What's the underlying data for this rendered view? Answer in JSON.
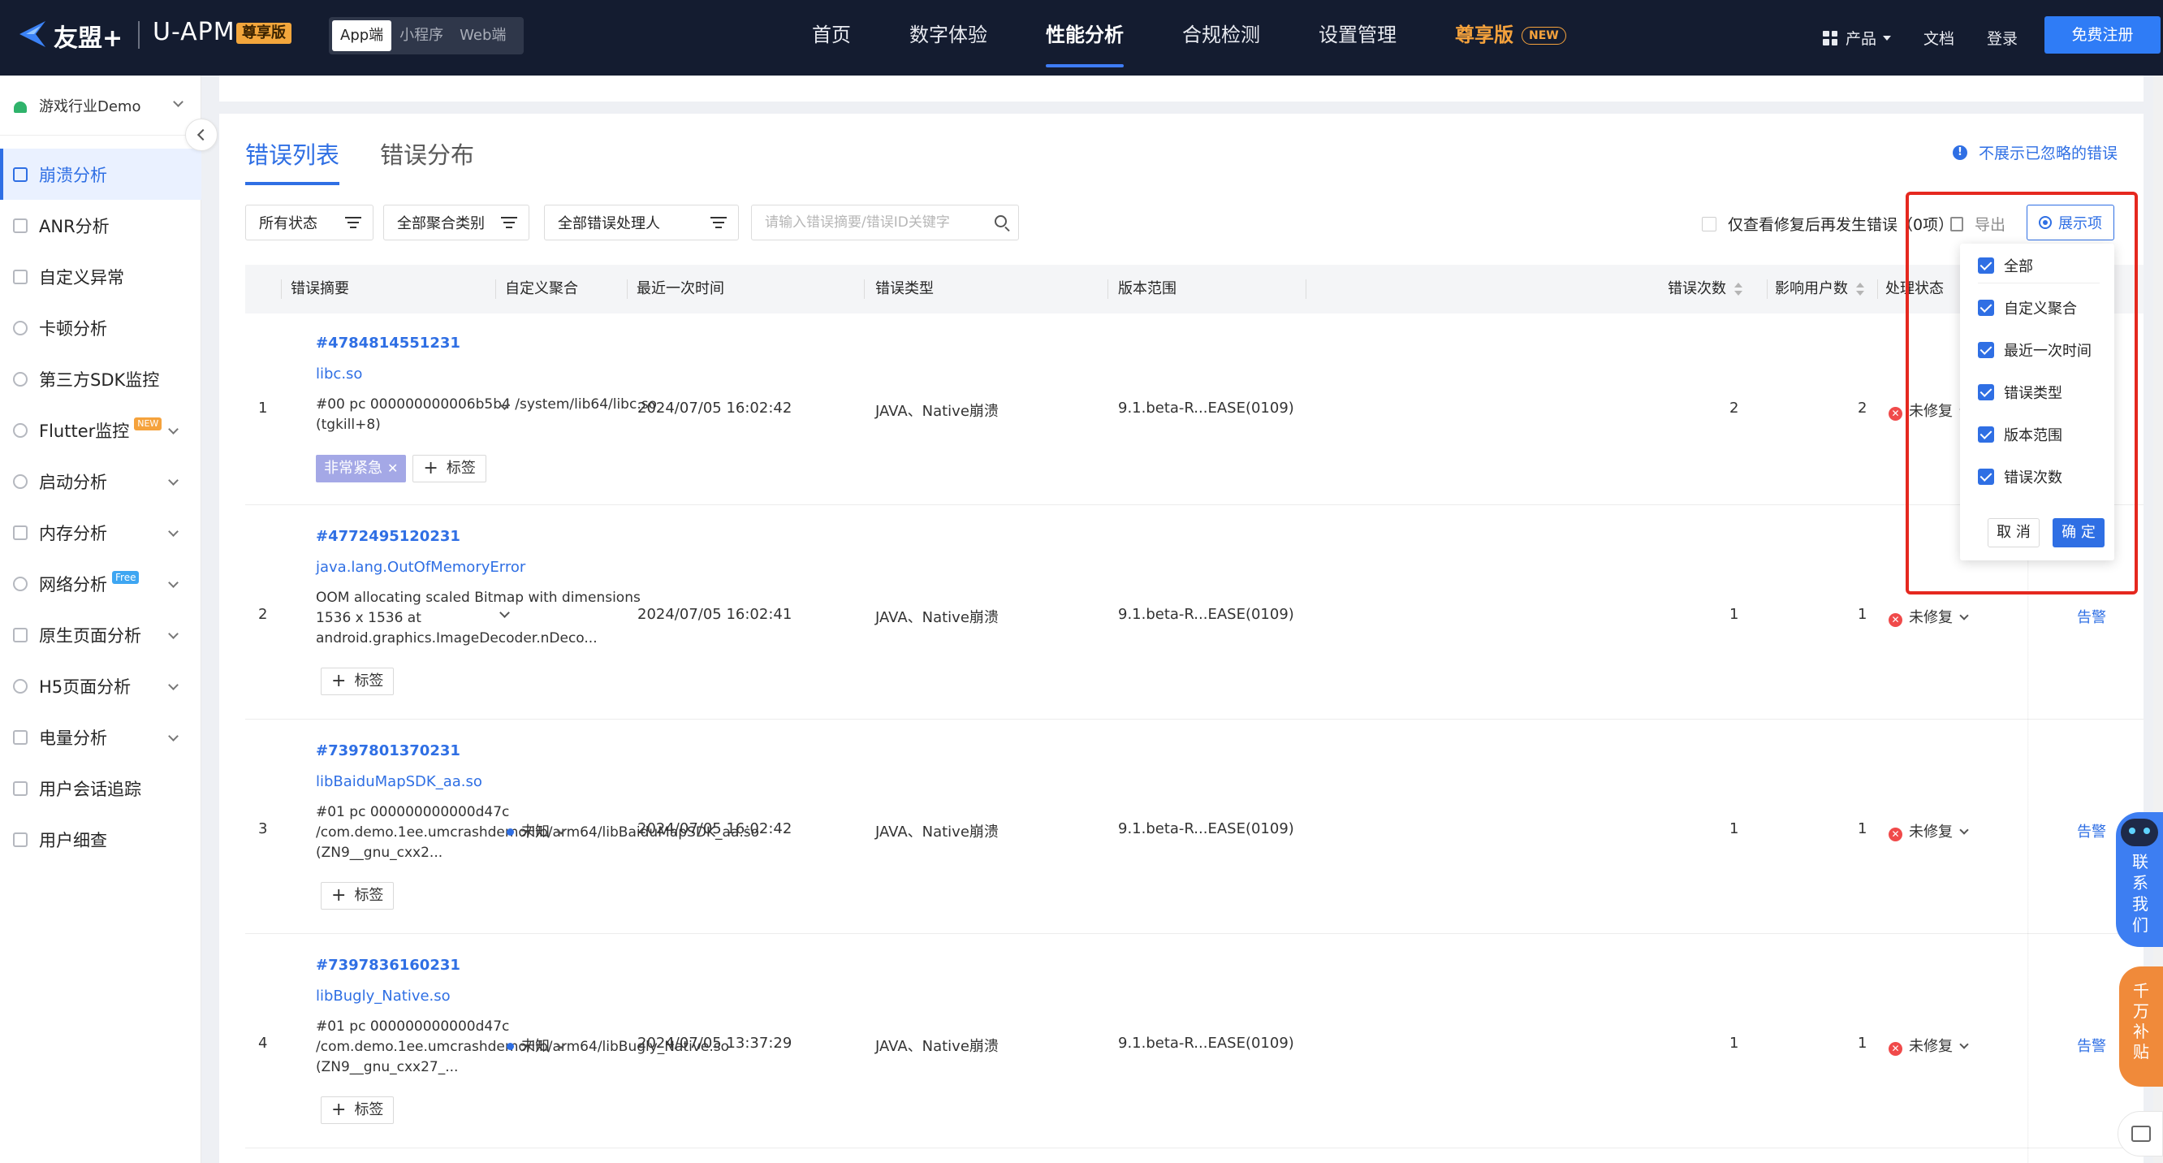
{
  "brand": {
    "name": "友盟+",
    "product": "U-APM",
    "badge": "尊享版"
  },
  "platform_tabs": [
    "App端",
    "小程序",
    "Web端"
  ],
  "main_nav": [
    {
      "label": "首页"
    },
    {
      "label": "数字体验"
    },
    {
      "label": "性能分析",
      "active": true
    },
    {
      "label": "合规检测"
    },
    {
      "label": "设置管理"
    },
    {
      "label": "尊享版",
      "badge": "NEW"
    }
  ],
  "right_nav": {
    "products": "产品",
    "docs": "文档",
    "login": "登录",
    "register": "免费注册"
  },
  "sidebar": {
    "app_name": "游戏行业Demo",
    "items": [
      {
        "label": "崩溃分析",
        "active": true
      },
      {
        "label": "ANR分析"
      },
      {
        "label": "自定义异常"
      },
      {
        "label": "卡顿分析"
      },
      {
        "label": "第三方SDK监控"
      },
      {
        "label": "Flutter监控",
        "tag": "NEW"
      },
      {
        "label": "启动分析"
      },
      {
        "label": "内存分析"
      },
      {
        "label": "网络分析",
        "tag": "Free"
      },
      {
        "label": "原生页面分析"
      },
      {
        "label": "H5页面分析"
      },
      {
        "label": "电量分析"
      },
      {
        "label": "用户会话追踪"
      },
      {
        "label": "用户细查"
      }
    ]
  },
  "tabs": [
    "错误列表",
    "错误分布"
  ],
  "ignore_link": "不展示已忽略的错误",
  "filters": {
    "status": "所有状态",
    "aggregation": "全部聚合类别",
    "handler": "全部错误处理人",
    "search_placeholder": "请输入错误摘要/错误ID关键字"
  },
  "toolbar": {
    "fixed_only": "仅查看修复后再发生错误（0项）",
    "export": "导出",
    "display": "展示项"
  },
  "table": {
    "headers": {
      "summary": "错误摘要",
      "custom_agg": "自定义聚合",
      "last_time": "最近一次时间",
      "error_type": "错误类型",
      "version": "版本范围",
      "count": "错误次数",
      "users": "影响用户数",
      "status": "处理状态"
    },
    "rows": [
      {
        "index": "1",
        "id": "#4784814551231",
        "lib": "libc.so",
        "stack": "#00 pc 000000000006b5b4 /system/lib64/libc.so (tgkill+8)",
        "tag": "非常紧急",
        "add_label": "标签",
        "custom_agg": "",
        "time": "2024/07/05 16:02:42",
        "type": "JAVA、Native崩溃",
        "version": "9.1.beta-R...EASE(0109)",
        "count": "2",
        "users": "2",
        "status": "未修复",
        "alert": ""
      },
      {
        "index": "2",
        "id": "#4772495120231",
        "lib": "java.lang.OutOfMemoryError",
        "stack": "OOM allocating scaled Bitmap with dimensions 1536 x 1536 at android.graphics.ImageDecoder.nDeco...",
        "add_label": "标签",
        "custom_agg": "",
        "time": "2024/07/05 16:02:41",
        "type": "JAVA、Native崩溃",
        "version": "9.1.beta-R...EASE(0109)",
        "count": "1",
        "users": "1",
        "status": "未修复",
        "alert": "告警"
      },
      {
        "index": "3",
        "id": "#7397801370231",
        "lib": "libBaiduMapSDK_aa.so",
        "stack": "#01 pc 000000000000d47c /com.demo.1ee.umcrashdemo/lib/arm64/libBaiduMapSDK_aa.so (ZN9__gnu_cxx2...",
        "add_label": "标签",
        "custom_agg": "未知",
        "time": "2024/07/05 16:02:42",
        "type": "JAVA、Native崩溃",
        "version": "9.1.beta-R...EASE(0109)",
        "count": "1",
        "users": "1",
        "status": "未修复",
        "alert": "告警"
      },
      {
        "index": "4",
        "id": "#7397836160231",
        "lib": "libBugly_Native.so",
        "stack": "#01 pc 000000000000d47c /com.demo.1ee.umcrashdemo/lib/arm64/libBugly_Native.so (ZN9__gnu_cxx27_...",
        "add_label": "标签",
        "custom_agg": "未知",
        "time": "2024/07/05 13:37:29",
        "type": "JAVA、Native崩溃",
        "version": "9.1.beta-R...EASE(0109)",
        "count": "1",
        "users": "1",
        "status": "未修复",
        "alert": "告警"
      }
    ]
  },
  "display_dropdown": {
    "options": [
      "全部",
      "自定义聚合",
      "最近一次时间",
      "错误类型",
      "版本范围",
      "错误次数"
    ],
    "checked": [
      true,
      true,
      true,
      true,
      true,
      true
    ],
    "cancel": "取 消",
    "ok": "确 定"
  },
  "floating": {
    "contact": "联系我们",
    "subsidy": "千万补贴"
  },
  "colors": {
    "nav_bg": "#141c30",
    "accent": "#2f6fe4",
    "vip": "#f5a23c",
    "highlight": "#e5281f"
  }
}
